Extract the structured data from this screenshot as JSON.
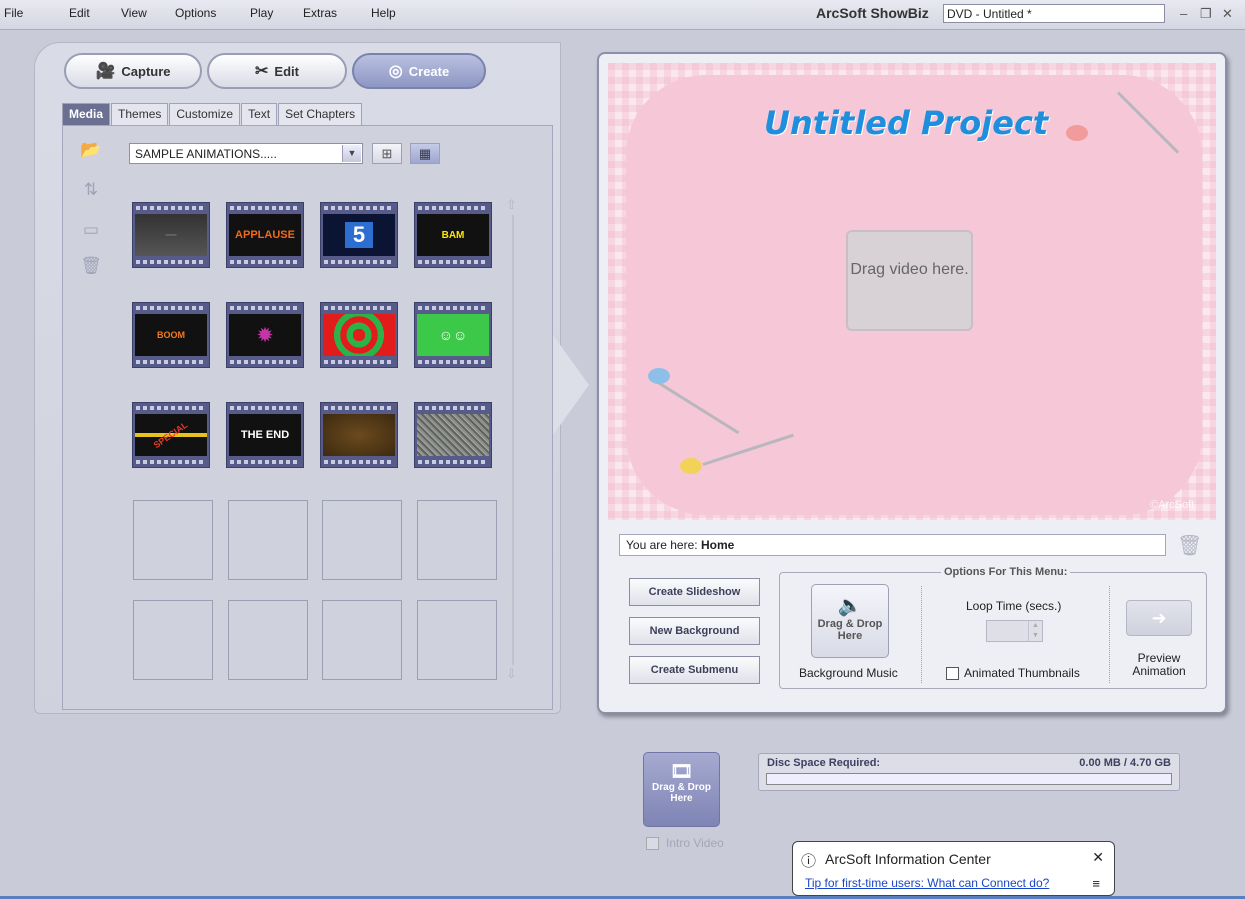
{
  "menubar": {
    "items": [
      {
        "label": "File"
      },
      {
        "label": "Edit"
      },
      {
        "label": "View"
      },
      {
        "label": "Options"
      },
      {
        "label": "Play"
      },
      {
        "label": "Extras"
      },
      {
        "label": "Help"
      }
    ],
    "app_title": "ArcSoft ShowBiz",
    "document_title": "DVD - Untitled *"
  },
  "modes": {
    "capture": "Capture",
    "edit": "Edit",
    "create": "Create",
    "active": "create"
  },
  "tabs": [
    {
      "label": "Media",
      "active": true
    },
    {
      "label": "Themes"
    },
    {
      "label": "Customize"
    },
    {
      "label": "Text"
    },
    {
      "label": "Set Chapters"
    }
  ],
  "media": {
    "category": "SAMPLE ANIMATIONS.....",
    "thumbnails": [
      {
        "name": "blank-dark"
      },
      {
        "name": "applause",
        "text": "APPLAUSE"
      },
      {
        "name": "countdown-5",
        "text": "5"
      },
      {
        "name": "bam",
        "text": "BAM"
      },
      {
        "name": "boom",
        "text": "BOOM"
      },
      {
        "name": "star-burst"
      },
      {
        "name": "spiral"
      },
      {
        "name": "cartoon-crowd"
      },
      {
        "name": "special",
        "text": "SPECIAL"
      },
      {
        "name": "the-end",
        "text": "THE END"
      },
      {
        "name": "brown-frame"
      },
      {
        "name": "static-noise"
      }
    ]
  },
  "preview": {
    "project_title": "Untitled Project",
    "drop_video_label": "Drag video here.",
    "watermark": "©ArcSoft"
  },
  "breadcrumb": {
    "prefix": "You are here: ",
    "location": "Home"
  },
  "actions": {
    "create_slideshow": "Create Slideshow",
    "new_background": "New Background",
    "create_submenu": "Create Submenu"
  },
  "options": {
    "title": "Options For This Menu:",
    "music_drop_label": "Drag & Drop Here",
    "background_music_label": "Background Music",
    "loop_time_label": "Loop Time (secs.)",
    "animated_thumbnails_label": "Animated Thumbnails",
    "preview_animation_label": "Preview Animation"
  },
  "intro": {
    "drop_label": "Drag & Drop Here",
    "checkbox_label": "Intro Video"
  },
  "disc": {
    "label": "Disc Space Required:",
    "value": "0.00 MB / 4.70 GB",
    "used_fraction": 0.0
  },
  "info_center": {
    "title": "ArcSoft Information Center",
    "tip": "Tip for first-time users: What can Connect do?"
  },
  "colors": {
    "accent": "#1f8edc",
    "panel": "#cfd1dd",
    "preview_bg": "#f6c7d6"
  }
}
